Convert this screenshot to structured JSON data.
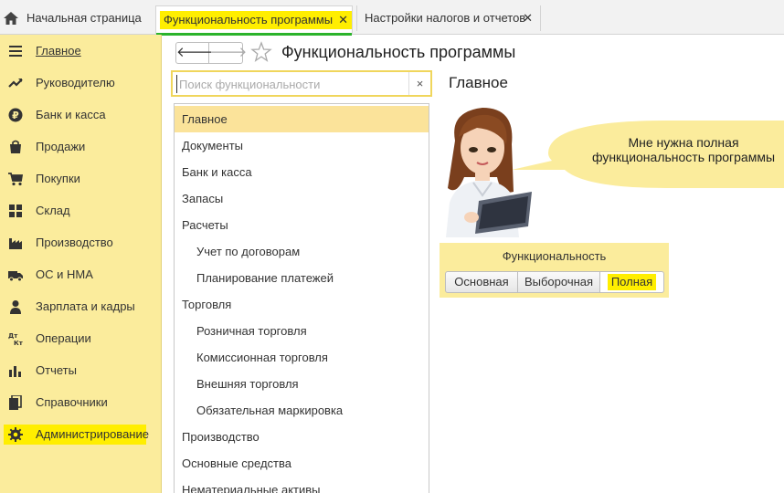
{
  "tabs": [
    {
      "label": "Начальная страница",
      "icon": "home-icon"
    },
    {
      "label": "Функциональность программы",
      "close": "✕",
      "active": true
    },
    {
      "label": "Настройки налогов и отчетов",
      "close": "✕"
    }
  ],
  "sidebar": {
    "items": [
      {
        "label": "Главное",
        "icon": "menu-icon"
      },
      {
        "label": "Руководителю",
        "icon": "trend-icon"
      },
      {
        "label": "Банк и касса",
        "icon": "ruble-icon"
      },
      {
        "label": "Продажи",
        "icon": "bag-icon"
      },
      {
        "label": "Покупки",
        "icon": "cart-icon"
      },
      {
        "label": "Склад",
        "icon": "warehouse-icon"
      },
      {
        "label": "Производство",
        "icon": "factory-icon"
      },
      {
        "label": "ОС и НМА",
        "icon": "truck-icon"
      },
      {
        "label": "Зарплата и кадры",
        "icon": "person-icon"
      },
      {
        "label": "Операции",
        "icon": "dt-kt-icon"
      },
      {
        "label": "Отчеты",
        "icon": "bar-chart-icon"
      },
      {
        "label": "Справочники",
        "icon": "books-icon"
      },
      {
        "label": "Администрирование",
        "icon": "gear-icon"
      }
    ]
  },
  "header": {
    "back": "🡐",
    "forward": "🡒",
    "title": "Функциональность программы"
  },
  "search": {
    "placeholder": "Поиск функциональности",
    "clear": "×"
  },
  "list": {
    "items": [
      {
        "label": "Главное",
        "indent": 0,
        "selected": true
      },
      {
        "label": "Документы",
        "indent": 0
      },
      {
        "label": "Банк и касса",
        "indent": 0
      },
      {
        "label": "Запасы",
        "indent": 0
      },
      {
        "label": "Расчеты",
        "indent": 0
      },
      {
        "label": "Учет по договорам",
        "indent": 1
      },
      {
        "label": "Планирование платежей",
        "indent": 1
      },
      {
        "label": "Торговля",
        "indent": 0
      },
      {
        "label": "Розничная торговля",
        "indent": 1
      },
      {
        "label": "Комиссионная торговля",
        "indent": 1
      },
      {
        "label": "Внешняя торговля",
        "indent": 1
      },
      {
        "label": "Обязательная маркировка",
        "indent": 1
      },
      {
        "label": "Производство",
        "indent": 0
      },
      {
        "label": "Основные средства",
        "indent": 0
      },
      {
        "label": "Нематериальные активы",
        "indent": 0
      }
    ]
  },
  "main": {
    "section_title": "Главное",
    "bubble_line1": "Мне нужна полная",
    "bubble_line2": "функциональность программы",
    "panel_title": "Функциональность",
    "options": [
      "Основная",
      "Выборочная",
      "Полная"
    ],
    "selected_option": "Полная"
  },
  "colors": {
    "sidebar_bg": "#fbec9c",
    "highlight": "#ffee00",
    "active_tab_underline": "#2bb32b",
    "selected_row": "#fbe39a"
  }
}
